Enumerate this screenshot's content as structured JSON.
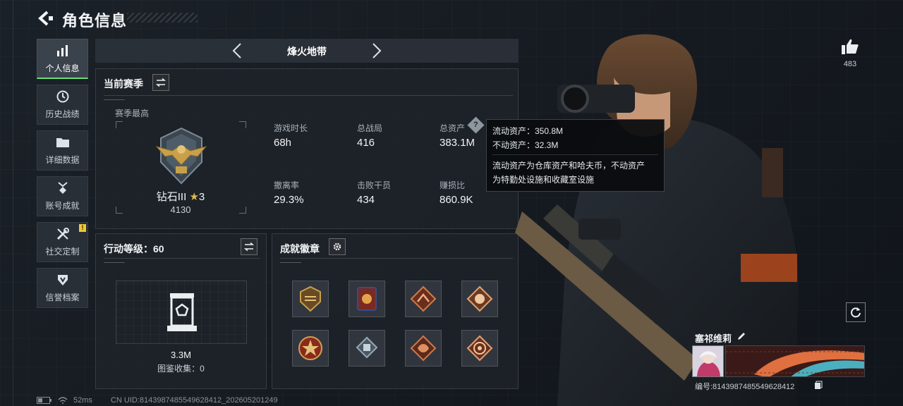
{
  "header": {
    "title": "角色信息"
  },
  "sidenav": {
    "items": [
      {
        "label": "个人信息",
        "icon": "bar-chart-icon",
        "active": true
      },
      {
        "label": "历史战绩",
        "icon": "clock-icon"
      },
      {
        "label": "详细数据",
        "icon": "folder-icon"
      },
      {
        "label": "账号成就",
        "icon": "medal-icon"
      },
      {
        "label": "社交定制",
        "icon": "tools-icon",
        "badge": "!"
      },
      {
        "label": "信誉档案",
        "icon": "shield-icon"
      }
    ]
  },
  "mode": {
    "title": "烽火地带"
  },
  "season": {
    "title": "当前赛季",
    "best_label": "赛季最高",
    "rank_name": "钻石III",
    "rank_stars": "3",
    "rank_points": "4130",
    "stats": [
      {
        "label": "游戏时长",
        "value": "68h"
      },
      {
        "label": "总战局",
        "value": "416"
      },
      {
        "label": "总资产",
        "value": "383.1M",
        "help": "?"
      },
      {
        "label": "撤离率",
        "value": "29.3%"
      },
      {
        "label": "击败干员",
        "value": "434"
      },
      {
        "label": "赚损比",
        "value": "860.9K"
      }
    ]
  },
  "tooltip": {
    "liquid": "流动资产：350.8M",
    "fixed": "不动资产：32.3M",
    "desc1": "流动资产为仓库资产和哈夫币，不动资产",
    "desc2": "为特勤处设施和收藏室设施"
  },
  "action_level": {
    "title": "行动等级：60",
    "collection_value": "3.3M",
    "collection_label": "图鉴收集：0"
  },
  "achievements": {
    "title": "成就徽章",
    "badges": [
      "badge-1",
      "badge-2",
      "badge-3",
      "badge-4",
      "badge-5",
      "badge-6",
      "badge-7",
      "badge-8"
    ]
  },
  "profile": {
    "likes": "483",
    "name": "塞祁维莉",
    "uid_label": "编号:8143987485549628412"
  },
  "status": {
    "ping": "52ms",
    "uid_text": "CN UID:8143987485549628412_202605201249"
  },
  "colors": {
    "accent_green": "#6adf7a",
    "badge_yellow": "#f0c832",
    "gold": "#c9a04a"
  }
}
